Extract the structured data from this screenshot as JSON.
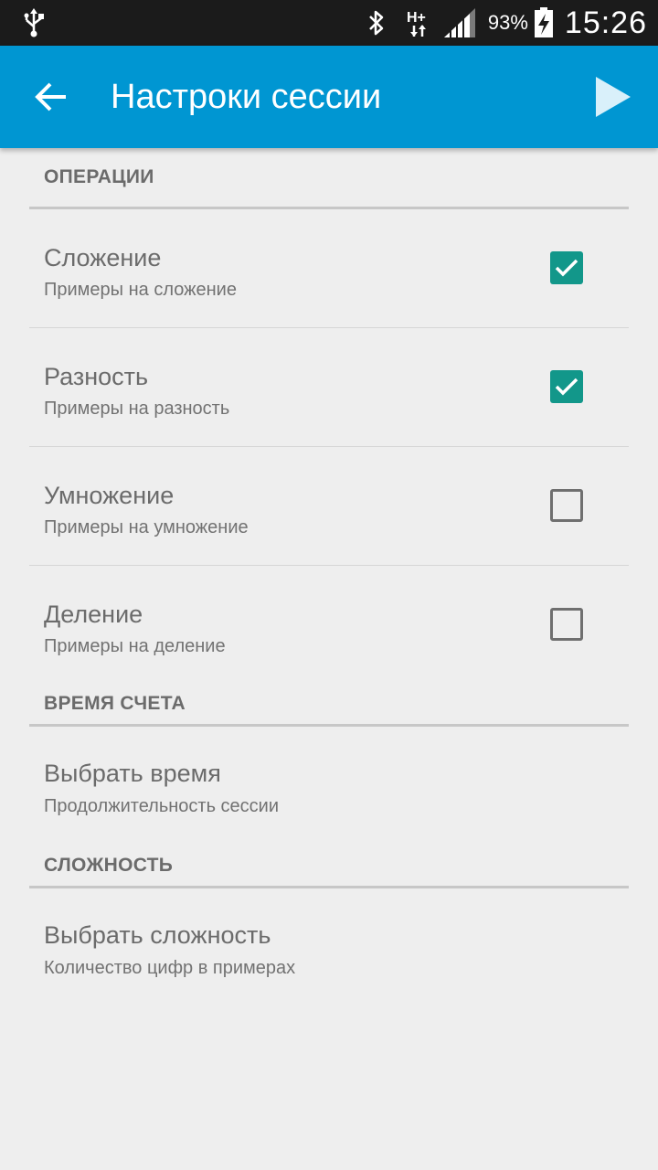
{
  "status_bar": {
    "battery_percent": "93%",
    "time": "15:26",
    "network_type": "H+",
    "icons": [
      "usb-icon",
      "bluetooth-icon",
      "network-hplus-icon",
      "signal-icon",
      "battery-charging-icon"
    ]
  },
  "toolbar": {
    "title": "Настроки сессии",
    "back_icon": "arrow-back-icon",
    "action_icon": "play-icon",
    "accent_color": "#0096d2"
  },
  "sections": {
    "operations": {
      "header": "ОПЕРАЦИИ",
      "items": [
        {
          "title": "Сложение",
          "subtitle": "Примеры на сложение",
          "checked": true
        },
        {
          "title": "Разность",
          "subtitle": "Примеры на разность",
          "checked": true
        },
        {
          "title": "Умножение",
          "subtitle": "Примеры на умножение",
          "checked": false
        },
        {
          "title": "Деление",
          "subtitle": "Примеры на деление",
          "checked": false
        }
      ]
    },
    "time": {
      "header": "ВРЕМЯ СЧЕТА",
      "item": {
        "title": "Выбрать время",
        "subtitle": "Продолжительность сессии"
      }
    },
    "difficulty": {
      "header": "СЛОЖНОСТЬ",
      "item": {
        "title": "Выбрать сложность",
        "subtitle": "Количество цифр в примерах"
      }
    }
  },
  "colors": {
    "checkbox_checked": "#12978a",
    "background": "#eeeeee",
    "status_bar": "#1b1b1b"
  }
}
